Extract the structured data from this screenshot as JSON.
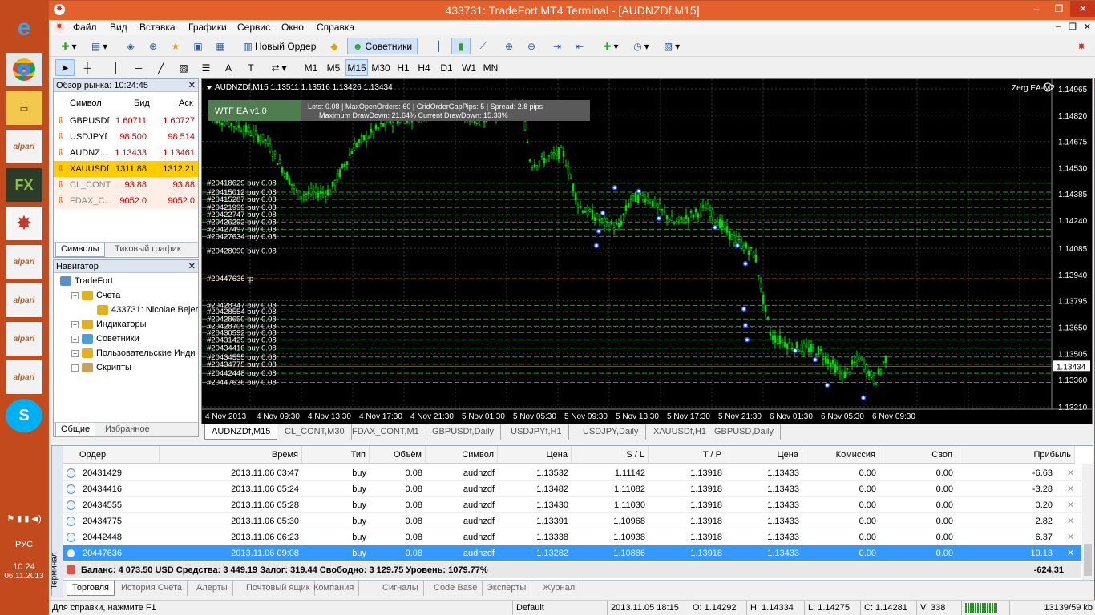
{
  "window": {
    "title": "433731: TradeFort MT4 Terminal - [AUDNZDf,M15]"
  },
  "menu": [
    "Файл",
    "Вид",
    "Вставка",
    "Графики",
    "Сервис",
    "Окно",
    "Справка"
  ],
  "toolbar": {
    "new_order": "Новый Ордер",
    "advisors": "Советники"
  },
  "timeframes": [
    "M1",
    "M5",
    "M15",
    "M30",
    "H1",
    "H4",
    "D1",
    "W1",
    "MN"
  ],
  "active_timeframe": "M15",
  "market_watch": {
    "title": "Обзор рынка: 10:24:45",
    "col_symbol": "Символ",
    "col_bid": "Бид",
    "col_ask": "Аск",
    "rows": [
      {
        "symbol": "GBPUSDf",
        "bid": "1.60711",
        "ask": "1.60727",
        "style": "normal"
      },
      {
        "symbol": "USDJPYf",
        "bid": "98.500",
        "ask": "98.514",
        "style": "normal"
      },
      {
        "symbol": "AUDNZ...",
        "bid": "1.13433",
        "ask": "1.13461",
        "style": "normal"
      },
      {
        "symbol": "XAUUSDf",
        "bid": "1311.88",
        "ask": "1312.21",
        "style": "highlight"
      },
      {
        "symbol": "CL_CONT",
        "bid": "93.88",
        "ask": "93.88",
        "style": "disabled"
      },
      {
        "symbol": "FDAX_C...",
        "bid": "9052.0",
        "ask": "9052.0",
        "style": "disabled"
      }
    ],
    "tabs": [
      "Символы",
      "Тиковый график"
    ]
  },
  "navigator": {
    "title": "Навигатор",
    "items": [
      {
        "label": "TradeFort",
        "level": 0,
        "icon": "terminal-icon"
      },
      {
        "label": "Счета",
        "level": 1,
        "icon": "accounts-icon"
      },
      {
        "label": "433731: Nicolae Bejer",
        "level": 2,
        "icon": "user-icon"
      },
      {
        "label": "Индикаторы",
        "level": 1,
        "icon": "indicators-icon"
      },
      {
        "label": "Советники",
        "level": 1,
        "icon": "experts-icon"
      },
      {
        "label": "Пользовательские Инди",
        "level": 1,
        "icon": "custom-indicators-icon"
      },
      {
        "label": "Скрипты",
        "level": 1,
        "icon": "scripts-icon"
      }
    ],
    "tabs": [
      "Общие",
      "Избранное"
    ]
  },
  "chart": {
    "header": "AUDNZDf,M15  1.13511 1.13516 1.13426 1.13434",
    "ea_label": "Zerg EA-M2",
    "ea_name": "WTF EA v1.0",
    "ea_info_line1": "Lots: 0.08  |  MaxOpenOrders: 60  |  GridOrderGapPips: 5  |  Spread: 2.8 pips",
    "ea_info_line2": "Maximum DrawDown: 21.64%          Current DrawDown: 15.33%",
    "current_price": "1.13434",
    "price_labels": [
      "1.14965",
      "1.14820",
      "1.14675",
      "1.14530",
      "1.14385",
      "1.14240",
      "1.14085",
      "1.13940",
      "1.13795",
      "1.13650",
      "1.13505",
      "1.13360",
      "1.13210"
    ],
    "time_labels": [
      "4 Nov 2013",
      "4 Nov 09:30",
      "4 Nov 13:30",
      "4 Nov 17:30",
      "4 Nov 21:30",
      "5 Nov 01:30",
      "5 Nov 05:30",
      "5 Nov 09:30",
      "5 Nov 13:30",
      "5 Nov 17:30",
      "5 Nov 21:30",
      "6 Nov 01:30",
      "6 Nov 05:30",
      "6 Nov 09:30"
    ],
    "order_labels_top": [
      "#20418629 buy 0.08",
      "#20415012 buy 0.08",
      "#20415287 buy 0.08",
      "#20421999 buy 0.08",
      "#20422747 buy 0.08",
      "#20426292 buy 0.08",
      "#20427497 buy 0.08",
      "#20427634 buy 0.08"
    ],
    "order_label_mid": "#20428090 buy 0.08",
    "tp_label": "#20447636 tp",
    "order_labels_bottom": [
      "#20428347 buy 0.08",
      "#20428554 buy 0.08",
      "#20428650 buy 0.08",
      "#20428705 buy 0.08",
      "#20430592 buy 0.08",
      "#20431429 buy 0.08",
      "#20434416 buy 0.08",
      "#20434555 buy 0.08",
      "#20434775 buy 0.08",
      "#20442448 buy 0.08",
      "#20447636 buy 0.08"
    ]
  },
  "chart_tabs": [
    "AUDNZDf,M15",
    "CL_CONT,M30",
    "FDAX_CONT,M1",
    "GBPUSDf,Daily",
    "USDJPYf,H1",
    "USDJPY,Daily",
    "XAUUSDf,H1",
    "GBPUSD,Daily"
  ],
  "terminal": {
    "side_label": "Терминал",
    "columns": [
      "Ордер",
      "Время",
      "Тип",
      "Объём",
      "Символ",
      "Цена",
      "S / L",
      "T / P",
      "Цена",
      "Комиссия",
      "Своп",
      "Прибыль"
    ],
    "rows": [
      {
        "order": "20431429",
        "time": "2013.11.06 03:47",
        "type": "buy",
        "volume": "0.08",
        "symbol": "audnzdf",
        "price": "1.13532",
        "sl": "1.11142",
        "tp": "1.13918",
        "cur": "1.13433",
        "commission": "0.00",
        "swap": "0.00",
        "profit": "-6.63"
      },
      {
        "order": "20434416",
        "time": "2013.11.06 05:24",
        "type": "buy",
        "volume": "0.08",
        "symbol": "audnzdf",
        "price": "1.13482",
        "sl": "1.11082",
        "tp": "1.13918",
        "cur": "1.13433",
        "commission": "0.00",
        "swap": "0.00",
        "profit": "-3.28"
      },
      {
        "order": "20434555",
        "time": "2013.11.06 05:28",
        "type": "buy",
        "volume": "0.08",
        "symbol": "audnzdf",
        "price": "1.13430",
        "sl": "1.11030",
        "tp": "1.13918",
        "cur": "1.13433",
        "commission": "0.00",
        "swap": "0.00",
        "profit": "0.20"
      },
      {
        "order": "20434775",
        "time": "2013.11.06 05:30",
        "type": "buy",
        "volume": "0.08",
        "symbol": "audnzdf",
        "price": "1.13391",
        "sl": "1.10968",
        "tp": "1.13918",
        "cur": "1.13433",
        "commission": "0.00",
        "swap": "0.00",
        "profit": "2.82"
      },
      {
        "order": "20442448",
        "time": "2013.11.06 06:23",
        "type": "buy",
        "volume": "0.08",
        "symbol": "audnzdf",
        "price": "1.13338",
        "sl": "1.10938",
        "tp": "1.13918",
        "cur": "1.13433",
        "commission": "0.00",
        "swap": "0.00",
        "profit": "6.37"
      },
      {
        "order": "20447636",
        "time": "2013.11.06 09:08",
        "type": "buy",
        "volume": "0.08",
        "symbol": "audnzdf",
        "price": "1.13282",
        "sl": "1.10886",
        "tp": "1.13918",
        "cur": "1.13433",
        "commission": "0.00",
        "swap": "0.00",
        "profit": "10.13"
      }
    ],
    "selected_row": 5,
    "balance": "Баланс: 4 073.50 USD  Средства: 3 449.19  Залог: 319.44  Свободно: 3 129.75  Уровень: 1079.77%",
    "total_profit": "-624.31",
    "tabs": [
      "Торговля",
      "История Счета",
      "Алерты",
      "Почтовый ящик",
      "Компания",
      "Сигналы",
      "Code Base",
      "Эксперты",
      "Журнал"
    ]
  },
  "status": {
    "help": "Для справки, нажмите F1",
    "profile": "Default",
    "datetime": "2013.11.05 18:15",
    "open": "O: 1.14292",
    "high": "H: 1.14334",
    "low": "L: 1.14275",
    "close": "C: 1.14281",
    "volume": "V: 338",
    "traffic": "13139/59 kb"
  },
  "os": {
    "lang": "РУС",
    "time": "10:24",
    "date": "06.11.2013"
  },
  "colors": {
    "title": "#e4612c",
    "chart_bg": "#000000",
    "candle": "#00ff00",
    "level_line": "#2f8f2f",
    "price_line": "#ff0000",
    "selected_row": "#3399ff"
  }
}
